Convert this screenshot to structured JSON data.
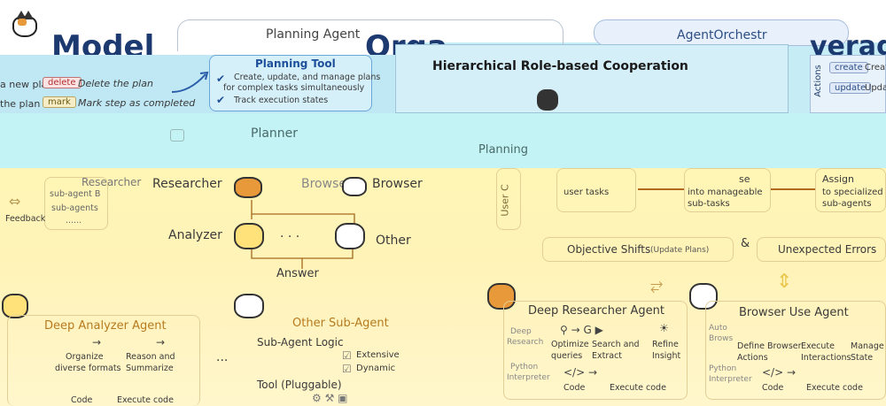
{
  "colors": {
    "blue_band": "#bfe7f4",
    "cyan_band": "#c3f3f5",
    "yellow_band": "#fff6b6",
    "accent": "#1c3a70",
    "orange": "#b77a1e"
  },
  "top": {
    "model_fragment": "Model",
    "planning_agent": "Planning Agent",
    "org_fragment": "Orga",
    "orchestrator": "AgentOrchestr",
    "verage_fragment": "verage"
  },
  "planning_tool": {
    "title": "Planning Tool",
    "points": [
      "Create, update, and manage plans",
      "for complex tasks simultaneously",
      "Track execution states"
    ]
  },
  "plan_ops": {
    "new_plan": "a new plan",
    "delete": "delete",
    "delete_desc": "Delete the plan",
    "the_plan": "the plan",
    "mark": "mark",
    "mark_desc": "Mark step as completed"
  },
  "hierarchical": "Hierarchical Role-based Cooperation",
  "actions": {
    "label": "Actions",
    "create": "create",
    "create_desc": "Creat",
    "update": "update",
    "update_desc": "Upda"
  },
  "planner": "Planner",
  "planning": "Planning",
  "left_flow": {
    "researcher": "Researcher",
    "sub_agent": "sub-agent B",
    "sub_agents": "sub-agents",
    "dots": "......",
    "feedback": "Feedback"
  },
  "center_flow": {
    "researcher": "Researcher",
    "browser": "Browser",
    "browser2": "Browser",
    "analyzer": "Analyzer",
    "other": "Other",
    "dots": "· · ·",
    "answer": "Answer"
  },
  "user": "User C",
  "right_flow": {
    "user_tasks": "user tasks",
    "se": "se",
    "manageable": "into manageable",
    "sub_tasks": "sub-tasks",
    "assign": "Assign",
    "assign_sub": "to specialized",
    "assign_sub2": "sub-agents",
    "objective": "Objective Shifts",
    "objective_sub": "(Update Plans)",
    "amp": "&",
    "errors": "Unexpected Errors"
  },
  "deep_researcher": {
    "title": "Deep Researcher Agent",
    "deep": "Deep",
    "research": "Research",
    "optimize": "Optimize",
    "queries": "queries",
    "search": "Search and",
    "extract": "Extract",
    "refine": "Refine",
    "insight": "Insight",
    "python": "Python",
    "interpreter": "Interpreter",
    "code": "Code",
    "exec": "Execute code"
  },
  "browser_use": {
    "title": "Browser Use Agent",
    "auto": "Auto",
    "brows": "Brows",
    "define": "Define Browser",
    "actions": "Actions",
    "execute": "Execute",
    "interactions": "Interactions",
    "manage": "Manage",
    "state": "State",
    "python": "Python",
    "interpreter": "Interpreter",
    "code": "Code",
    "exec": "Execute code"
  },
  "deep_analyzer": {
    "title": "Deep Analyzer Agent",
    "organize": "Organize",
    "formats": "diverse formats",
    "reason": "Reason and",
    "summarize": "Summarize",
    "code": "Code",
    "exec": "Execute code",
    "dots": "..."
  },
  "other_sub": {
    "title": "Other Sub-Agent",
    "logic": "Sub-Agent Logic",
    "extensive": "Extensive",
    "dynamic": "Dynamic",
    "tool": "Tool (Pluggable)"
  }
}
